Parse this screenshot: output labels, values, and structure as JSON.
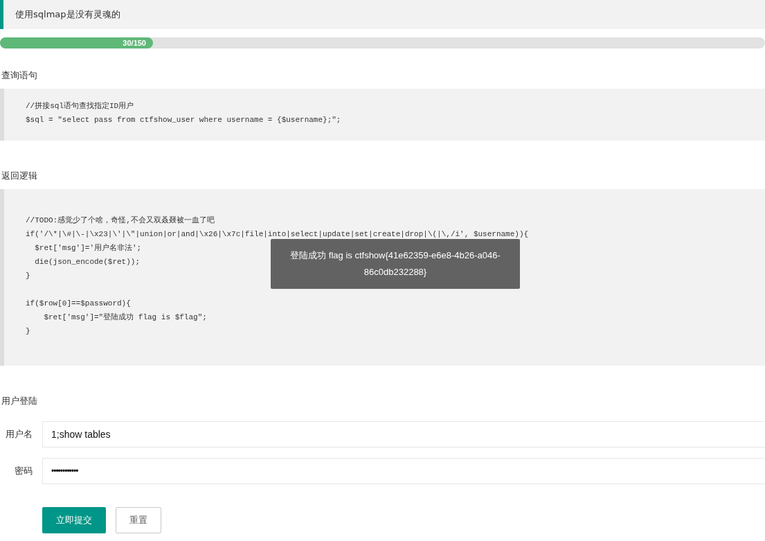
{
  "notice": "使用sqlmap是没有灵魂的",
  "progress": {
    "label": "30/150",
    "level": 0.2
  },
  "sections": [
    {
      "title": "查询语句",
      "code": [
        [
          "//拼接sql语句查找指定ID用户",
          "$sql = \"select pass from ctfshow_user where username = {$username};\";"
        ]
      ]
    },
    {
      "title": "返回逻辑",
      "code": [
        [
          "//TODO:感觉少了个啥，奇怪,不会又双叒叕被一血了吧",
          "if('/\\*|\\#|\\-|\\x23|\\'|\\\"|union|or|and|\\x26|\\x7c|file|into|select|update|set|create|drop|\\(|\\,/i', $username)){",
          "  $ret['msg']='用户名非法';",
          "  die(json_encode($ret));",
          "}"
        ],
        [
          "if($row[0]==$password){",
          "    $ret['msg']=\"登陆成功 flag is $flag\";",
          "}"
        ]
      ]
    }
  ],
  "toast": "登陆成功 flag is ctfshow{41e62359-e6e8-4b26-a046-86c0db232288}",
  "login": {
    "title": "用户登陆",
    "fields": [
      {
        "label": "用户名",
        "value": "1;show tables",
        "kind": "text"
      },
      {
        "label": "密码",
        "value": "••••••••••••",
        "kind": "password"
      }
    ],
    "buttons": [
      {
        "label": "立即提交",
        "kind": "primary"
      },
      {
        "label": "重置",
        "kind": "secondary"
      }
    ]
  }
}
